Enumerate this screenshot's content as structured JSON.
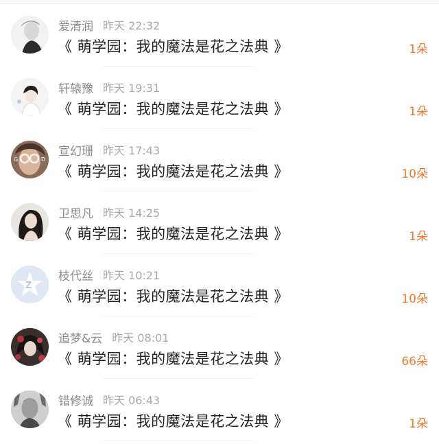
{
  "gift_list": {
    "items": [
      {
        "username": "爱清润",
        "time": "昨天 22:32",
        "book_title": "《 萌学园：我的魔法是花之法典 》",
        "amount": "1朵",
        "avatar": "avatar-grey-portrait-icon"
      },
      {
        "username": "轩辕豫",
        "time": "昨天 19:31",
        "book_title": "《 萌学园：我的魔法是花之法典 》",
        "amount": "1朵",
        "avatar": "avatar-boy-illustration-icon"
      },
      {
        "username": "宣幻珊",
        "time": "昨天 17:43",
        "book_title": "《 萌学园：我的魔法是花之法典 》",
        "amount": "10朵",
        "avatar": "avatar-girl-good-glasses-icon"
      },
      {
        "username": "卫思凡",
        "time": "昨天 14:25",
        "book_title": "《 萌学园：我的魔法是花之法典 》",
        "amount": "1朵",
        "avatar": "avatar-woman-portrait-icon"
      },
      {
        "username": "枝代丝",
        "time": "昨天 10:21",
        "book_title": "《 萌学园：我的魔法是花之法典 》",
        "amount": "10朵",
        "avatar": "avatar-default-qq-icon"
      },
      {
        "username": "追梦&云",
        "time": "昨天 08:01",
        "book_title": "《 萌学园：我的魔法是花之法典 》",
        "amount": "66朵",
        "avatar": "avatar-dark-floral-icon"
      },
      {
        "username": "错修诚",
        "time": "昨天 06:43",
        "book_title": "《 萌学园：我的魔法是花之法典 》",
        "amount": "1朵",
        "avatar": "avatar-man-bw-portrait-icon"
      }
    ]
  },
  "colors": {
    "amount": "#f07a2e",
    "username": "#8a8a8a",
    "time": "#a8a8a8",
    "title": "#222222"
  }
}
